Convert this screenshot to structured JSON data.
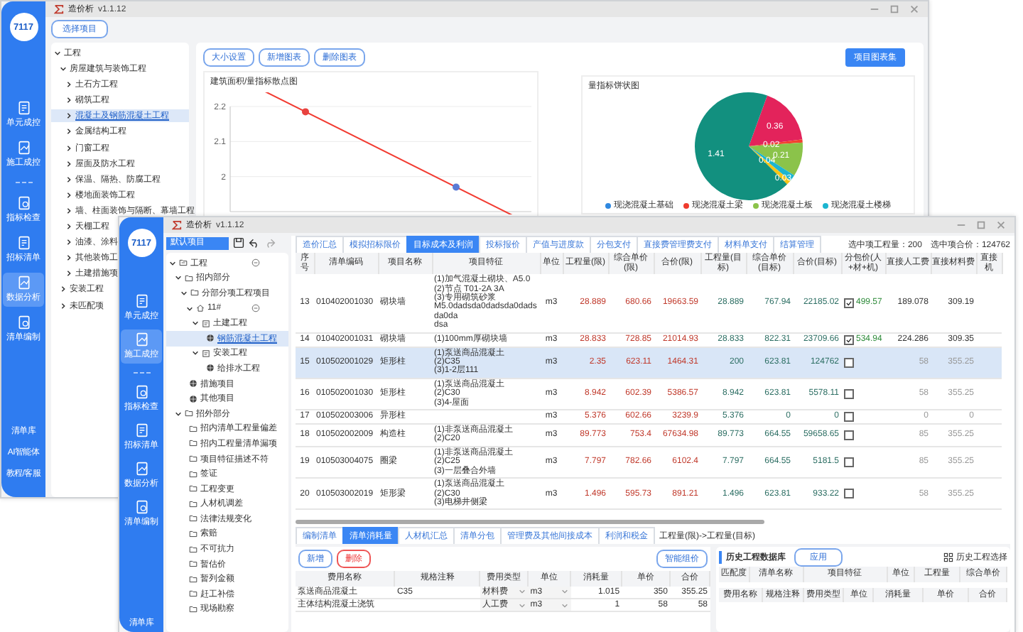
{
  "back_window": {
    "title": "造价析",
    "version": "v1.1.12",
    "sidebar": {
      "logo": "7117",
      "items": [
        {
          "label": "单元成控",
          "selected": false
        },
        {
          "label": "施工成控",
          "selected": false
        },
        {
          "label": "指标检查",
          "selected": false
        },
        {
          "label": "招标清单",
          "selected": false
        },
        {
          "label": "数据分析",
          "selected": true
        },
        {
          "label": "清单编制",
          "selected": false
        }
      ],
      "bottom_items": [
        "清单库",
        "AI智能体",
        "教程/客服"
      ]
    },
    "select_project_button": "选择项目",
    "tree": [
      {
        "label": "工程",
        "expanded": true,
        "selected": false,
        "children": [
          {
            "label": "房屋建筑与装饰工程",
            "expanded": true,
            "selected": false,
            "children": [
              {
                "label": "土石方工程",
                "expanded": false,
                "selected": false
              },
              {
                "label": "砌筑工程",
                "expanded": false,
                "selected": false
              },
              {
                "label": "混凝土及钢筋混凝土工程",
                "expanded": false,
                "selected": true
              },
              {
                "label": "金属结构工程",
                "expanded": false,
                "selected": false
              },
              {
                "label": "门窗工程",
                "expanded": false,
                "selected": false
              },
              {
                "label": "屋面及防水工程",
                "expanded": false,
                "selected": false
              },
              {
                "label": "保温、隔热、防腐工程",
                "expanded": false,
                "selected": false
              },
              {
                "label": "楼地面装饰工程",
                "expanded": false,
                "selected": false
              },
              {
                "label": "墙、柱面装饰与隔断、幕墙工程",
                "expanded": false,
                "selected": false
              },
              {
                "label": "天棚工程",
                "expanded": false,
                "selected": false
              },
              {
                "label": "油漆、涂料",
                "expanded": false,
                "selected": false
              },
              {
                "label": "其他装饰工",
                "expanded": false,
                "selected": false
              },
              {
                "label": "土建措施项",
                "expanded": false,
                "selected": false
              }
            ]
          },
          {
            "label": "安装工程",
            "expanded": false,
            "selected": false
          },
          {
            "label": "未匹配项",
            "expanded": false,
            "selected": false
          }
        ]
      }
    ],
    "chart_buttons": [
      "大小设置",
      "新增图表",
      "删除图表"
    ],
    "primary_button": "项目图表集",
    "line_chart": {
      "chart_data": {
        "type": "scatter",
        "title": "建筑面积/量指标散点图",
        "categories": [
          null,
          null
        ],
        "ylim": [
          1.9,
          2.2
        ],
        "yticks": [
          2,
          2.1,
          2.2
        ],
        "grid": true,
        "series": [
          {
            "color": "#e8423f",
            "values": [
              2.185,
              null
            ]
          },
          {
            "color": "#5b7bd5",
            "values": [
              null,
              1.97
            ]
          }
        ]
      }
    },
    "pie_chart": {
      "chart_data": {
        "type": "pie",
        "title": "量指标饼状图",
        "data_labels": true,
        "series": [
          {
            "values": [
              0.36,
              0.02,
              0.21,
              0.04,
              0.03,
              1.41
            ]
          }
        ]
      },
      "slices": [
        {
          "color": "#e3235b"
        },
        {
          "color": "#f2412f"
        },
        {
          "color": "#8bc34a"
        },
        {
          "color": "#1cb5d0"
        },
        {
          "color": "#f5c518"
        },
        {
          "color": "#12907f"
        }
      ],
      "legend": [
        {
          "name": "现浇混凝土基础",
          "color": "#2f88e0"
        },
        {
          "name": "现浇混凝土梁",
          "color": "#ef3b2d"
        },
        {
          "name": "现浇混凝土板",
          "color": "#8bc34a"
        },
        {
          "name": "现浇混凝土楼梯",
          "color": "#1cb5d0"
        }
      ]
    }
  },
  "front_window": {
    "title": "造价析",
    "version": "v1.1.12",
    "sidebar": {
      "logo": "7117",
      "items": [
        {
          "label": "单元成控",
          "selected": false
        },
        {
          "label": "施工成控",
          "selected": true
        },
        {
          "label": "指标检查",
          "selected": false
        },
        {
          "label": "招标清单",
          "selected": false
        },
        {
          "label": "数据分析",
          "selected": false
        },
        {
          "label": "清单编制",
          "selected": false
        }
      ],
      "bottom_items": [
        "清单库"
      ]
    },
    "project_field": "默认项目",
    "tree": [
      {
        "label": "工程",
        "kind": "project",
        "expanded": true,
        "collapse_button": true,
        "selected": false,
        "children": [
          {
            "label": "招内部分",
            "kind": "folder",
            "expanded": true,
            "selected": false,
            "children": [
              {
                "label": "分部分项工程项目",
                "kind": "folder",
                "expanded": true,
                "selected": false,
                "children": [
                  {
                    "label": "11#",
                    "kind": "home",
                    "expanded": true,
                    "collapse_button": true,
                    "selected": false,
                    "children": [
                      {
                        "label": "土建工程",
                        "kind": "box",
                        "expanded": true,
                        "selected": false,
                        "children": [
                          {
                            "label": "钢筋混凝土工程",
                            "kind": "globe",
                            "selected": true
                          }
                        ]
                      },
                      {
                        "label": "安装工程",
                        "kind": "box",
                        "expanded": true,
                        "selected": false,
                        "children": [
                          {
                            "label": "给排水工程",
                            "kind": "globe",
                            "selected": false
                          }
                        ]
                      }
                    ]
                  }
                ]
              },
              {
                "label": "措施项目",
                "kind": "globe",
                "selected": false
              },
              {
                "label": "其他项目",
                "kind": "globe",
                "selected": false
              }
            ]
          },
          {
            "label": "招外部分",
            "kind": "folder",
            "expanded": true,
            "selected": false,
            "children": [
              {
                "label": "招内清单工程量偏差",
                "kind": "folder",
                "selected": false
              },
              {
                "label": "招内工程量清单漏项",
                "kind": "folder",
                "selected": false
              },
              {
                "label": "项目特征描述不符",
                "kind": "folder",
                "selected": false
              },
              {
                "label": "签证",
                "kind": "folder",
                "selected": false
              },
              {
                "label": "工程变更",
                "kind": "folder",
                "selected": false
              },
              {
                "label": "人材机调差",
                "kind": "folder",
                "selected": false
              },
              {
                "label": "法律法规变化",
                "kind": "folder",
                "selected": false
              },
              {
                "label": "索赔",
                "kind": "folder",
                "selected": false
              },
              {
                "label": "不可抗力",
                "kind": "folder",
                "selected": false
              },
              {
                "label": "暂估价",
                "kind": "folder",
                "selected": false
              },
              {
                "label": "暂列金额",
                "kind": "folder",
                "selected": false
              },
              {
                "label": "赶工补偿",
                "kind": "folder",
                "selected": false
              },
              {
                "label": "现场勘察",
                "kind": "folder",
                "selected": false
              }
            ]
          }
        ]
      }
    ],
    "tabs": [
      {
        "label": "造价汇总",
        "selected": false
      },
      {
        "label": "模拟招标限价",
        "selected": false
      },
      {
        "label": "目标成本及利润",
        "selected": true
      },
      {
        "label": "投标报价",
        "selected": false
      },
      {
        "label": "产值与进度款",
        "selected": false
      },
      {
        "label": "分包支付",
        "selected": false
      },
      {
        "label": "直接费管理费支付",
        "selected": false
      },
      {
        "label": "材料单支付",
        "selected": false
      },
      {
        "label": "结算管理",
        "selected": false
      }
    ],
    "summary": [
      "选中项工程量：200",
      "选中项合价：124762"
    ],
    "table": {
      "columns": [
        "序号",
        "清单编码",
        "项目名称",
        "项目特征",
        "单位",
        "工程量(限)",
        "综合单价(限)",
        "合价(限)",
        "工程量(目标)",
        "综合单价(目标)",
        "合价(目标)",
        "分包价(人+材+机)",
        "直接人工费",
        "直接材料费",
        "直接机"
      ],
      "rows": [
        {
          "no": "13",
          "code": "010402001030",
          "name": "砌块墙",
          "features": [
            "(1)加气混凝土砌块、A5.0",
            "(2)节点 T01-2A 3A",
            "(3)专用砌筑砂浆",
            "M5.0dadsda0dadsda0dadsda0da",
            "dsa"
          ],
          "unit": "m3",
          "qty_limit": "28.889",
          "price_limit": "680.66",
          "total_limit": "19663.59",
          "qty_target": "28.889",
          "price_target": "767.94",
          "total_target": "22185.02",
          "subcontract_checked": true,
          "subcontract": "499.57",
          "labor": "189.078",
          "material": "309.19",
          "selected": false
        },
        {
          "no": "14",
          "code": "010402001031",
          "name": "砌块墙",
          "features": [
            "(1)100mm厚砌块墙"
          ],
          "unit": "m3",
          "qty_limit": "28.833",
          "price_limit": "728.85",
          "total_limit": "21014.93",
          "qty_target": "28.833",
          "price_target": "822.31",
          "total_target": "23709.66",
          "subcontract_checked": true,
          "subcontract": "534.94",
          "labor": "224.286",
          "material": "309.35",
          "selected": false
        },
        {
          "no": "15",
          "code": "010502001029",
          "name": "矩形柱",
          "features": [
            "(1)泵送商品混凝土",
            "(2)C35",
            "(3)1-2层111"
          ],
          "unit": "m3",
          "qty_limit": "2.35",
          "price_limit": "623.11",
          "total_limit": "1464.31",
          "qty_target": "200",
          "price_target": "623.81",
          "total_target": "124762",
          "subcontract_checked": false,
          "labor": "58",
          "material": "355.25",
          "selected": true
        },
        {
          "no": "16",
          "code": "010502001030",
          "name": "矩形柱",
          "features": [
            "(1)泵送商品混凝土",
            "(2)C30",
            "(3)4-屋面"
          ],
          "unit": "m3",
          "qty_limit": "8.942",
          "price_limit": "602.39",
          "total_limit": "5386.57",
          "qty_target": "8.942",
          "price_target": "623.81",
          "total_target": "5578.11",
          "subcontract_checked": false,
          "labor": "58",
          "material": "355.25",
          "selected": false
        },
        {
          "no": "17",
          "code": "010502003006",
          "name": "异形柱",
          "features": [],
          "unit": "m3",
          "qty_limit": "5.376",
          "price_limit": "602.66",
          "total_limit": "3239.9",
          "qty_target": "5.376",
          "price_target": "0",
          "total_target": "0",
          "subcontract_checked": false,
          "labor": "0",
          "material": "0",
          "selected": false
        },
        {
          "no": "18",
          "code": "010502002009",
          "name": "构造柱",
          "features": [
            "(1)非泵送商品混凝土",
            "(2)C20"
          ],
          "unit": "m3",
          "qty_limit": "89.773",
          "price_limit": "753.4",
          "total_limit": "67634.98",
          "qty_target": "89.773",
          "price_target": "664.55",
          "total_target": "59658.65",
          "subcontract_checked": false,
          "labor": "85",
          "material": "355.25",
          "selected": false
        },
        {
          "no": "19",
          "code": "010503004075",
          "name": "圈梁",
          "features": [
            "(1)非泵送商品混凝土",
            "(2)C25",
            "(3)一层叠合外墙"
          ],
          "unit": "m3",
          "qty_limit": "7.797",
          "price_limit": "782.66",
          "total_limit": "6102.4",
          "qty_target": "7.797",
          "price_target": "664.55",
          "total_target": "5181.5",
          "subcontract_checked": false,
          "labor": "85",
          "material": "355.25",
          "selected": false
        },
        {
          "no": "20",
          "code": "010503002019",
          "name": "矩形梁",
          "features": [
            "(1)泵送商品混凝土",
            "(2)C30",
            "(3)电梯井侧梁"
          ],
          "unit": "m3",
          "qty_limit": "1.496",
          "price_limit": "595.73",
          "total_limit": "891.21",
          "qty_target": "1.496",
          "price_target": "623.81",
          "total_target": "933.22",
          "subcontract_checked": false,
          "labor": "58",
          "material": "355.25",
          "selected": false
        }
      ]
    },
    "bottom_tabs": [
      {
        "label": "编制清单",
        "selected": false
      },
      {
        "label": "清单消耗量",
        "selected": true
      },
      {
        "label": "人材机汇总",
        "selected": false
      },
      {
        "label": "清单分包",
        "selected": false
      },
      {
        "label": "管理费及其他间接成本",
        "selected": false
      },
      {
        "label": "利润和税金",
        "selected": false
      }
    ],
    "formula": "工程量(限)->工程量(目标)",
    "add_button": "新增",
    "delete_button": "删除",
    "smart_button": "智能组价",
    "cost_table": {
      "columns": [
        "费用名称",
        "规格注释",
        "费用类型",
        "单位",
        "消耗量",
        "单价",
        "合价"
      ],
      "rows": [
        {
          "name": "泵送商品混凝土",
          "spec": "C35",
          "type": "材料费",
          "unit": "m3",
          "amount": "1.015",
          "price": "350",
          "total": "355.25"
        },
        {
          "name": "主体结构混凝土浇筑",
          "type": "人工费",
          "unit": "m3",
          "amount": "1",
          "price": "58",
          "total": "58"
        }
      ]
    },
    "history": {
      "title": "历史工程数据库",
      "apply_button": "应用",
      "select_button": "历史工程选择",
      "columns": [
        "匹配度",
        "清单名称",
        "项目特征",
        "单位",
        "工程量",
        "综合单价"
      ],
      "detail_columns": [
        "费用名称",
        "规格注释",
        "费用类型",
        "单位",
        "消耗量",
        "单价",
        "合价"
      ]
    }
  }
}
